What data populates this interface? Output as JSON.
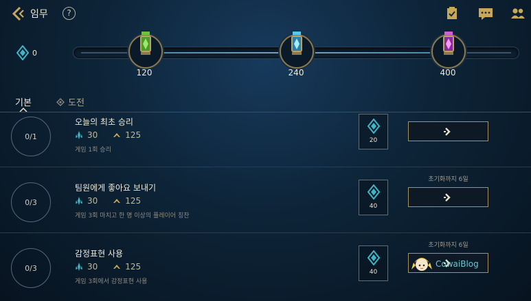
{
  "header": {
    "title": "임무",
    "help_symbol": "?",
    "icons": [
      "back-chevron-icon",
      "help-icon",
      "checklist-icon",
      "chat-icon",
      "friends-icon"
    ]
  },
  "progress": {
    "current_tokens": "0",
    "milestones": [
      {
        "value": "120",
        "jar_color": "#6ec33a"
      },
      {
        "value": "240",
        "jar_color": "#5bc6e8"
      },
      {
        "value": "400",
        "jar_color": "#d25fd6"
      }
    ]
  },
  "tabs": [
    {
      "label": "기본",
      "active": true
    },
    {
      "label": "도전",
      "active": false
    }
  ],
  "missions": [
    {
      "progress": "0/1",
      "name": "오늘의 최초 승리",
      "blue_essence": "30",
      "xp": "125",
      "description": "게임 1회 승리",
      "token_reward": "20",
      "reset_text": ""
    },
    {
      "progress": "0/3",
      "name": "팀원에게 좋아요 보내기",
      "blue_essence": "30",
      "xp": "125",
      "description": "게임 3회 마치고 한 명 이상의 플레이어 칭찬",
      "token_reward": "40",
      "reset_text": "초기화까지 6일"
    },
    {
      "progress": "0/3",
      "name": "감정표현 사용",
      "blue_essence": "30",
      "xp": "125",
      "description": "게임 3회에서 감정표현 사용",
      "token_reward": "40",
      "reset_text": "초기화까지 6일"
    }
  ],
  "watermark": {
    "text": "CowaiBlog"
  },
  "colors": {
    "gold_border": "#a89060",
    "token_teal": "#3fb6c6",
    "background": "#0d2438"
  }
}
